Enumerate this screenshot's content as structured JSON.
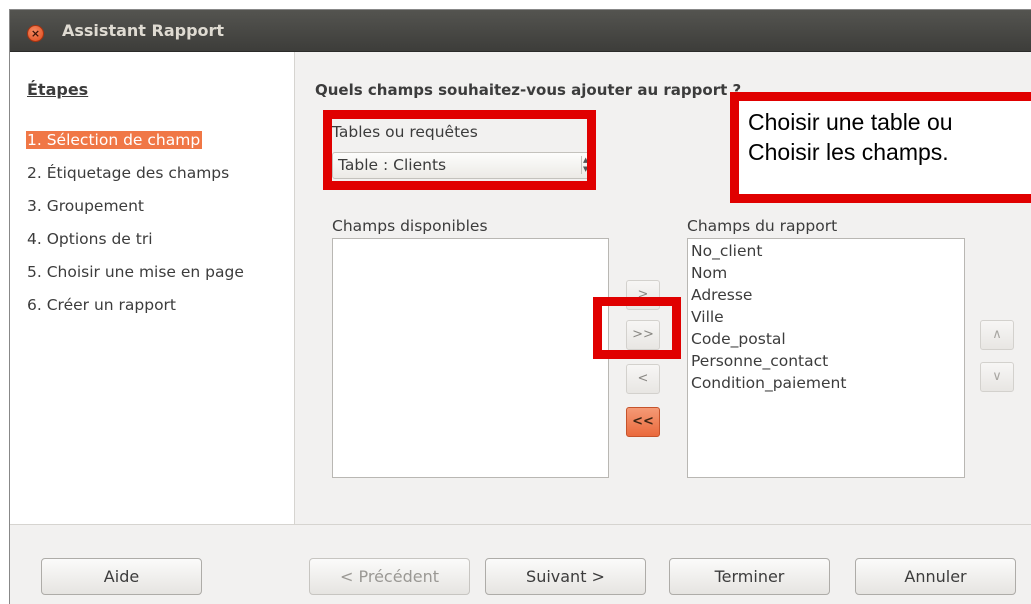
{
  "window": {
    "title": "Assistant Rapport"
  },
  "steps": {
    "title": "Étapes",
    "items": [
      {
        "label": "1. Sélection de champ",
        "active": true
      },
      {
        "label": "2. Étiquetage des champs",
        "active": false
      },
      {
        "label": "3. Groupement",
        "active": false
      },
      {
        "label": "4. Options de tri",
        "active": false
      },
      {
        "label": "5. Choisir une mise en page",
        "active": false
      },
      {
        "label": "6. Créer un rapport",
        "active": false
      }
    ]
  },
  "main": {
    "question": "Quels champs souhaitez-vous ajouter au rapport ?",
    "tables_label": "Tables ou requêtes",
    "table_value": "Table : Clients",
    "available_label": "Champs disponibles",
    "report_label": "Champs du rapport",
    "report_fields": [
      "No_client",
      "Nom",
      "Adresse",
      "Ville",
      "Code_postal",
      "Personne_contact",
      "Condition_paiement"
    ],
    "move": {
      "right_one": ">",
      "right_all": ">>",
      "left_one": "<",
      "left_all": "<<"
    },
    "order": {
      "up": "∧",
      "down": "∨"
    }
  },
  "annotation": {
    "line1": "Choisir une table ou",
    "line2": "Choisir les champs."
  },
  "footer": {
    "help": "Aide",
    "prev": "< Précédent",
    "next": "Suivant >",
    "finish": "Terminer",
    "cancel": "Annuler"
  },
  "colors": {
    "accent": "#f07746",
    "annotation_red": "#e00000",
    "titlebar": "#3d3d3a"
  },
  "icons": {
    "close": "close-icon",
    "combo": "spinner-arrows-icon"
  }
}
